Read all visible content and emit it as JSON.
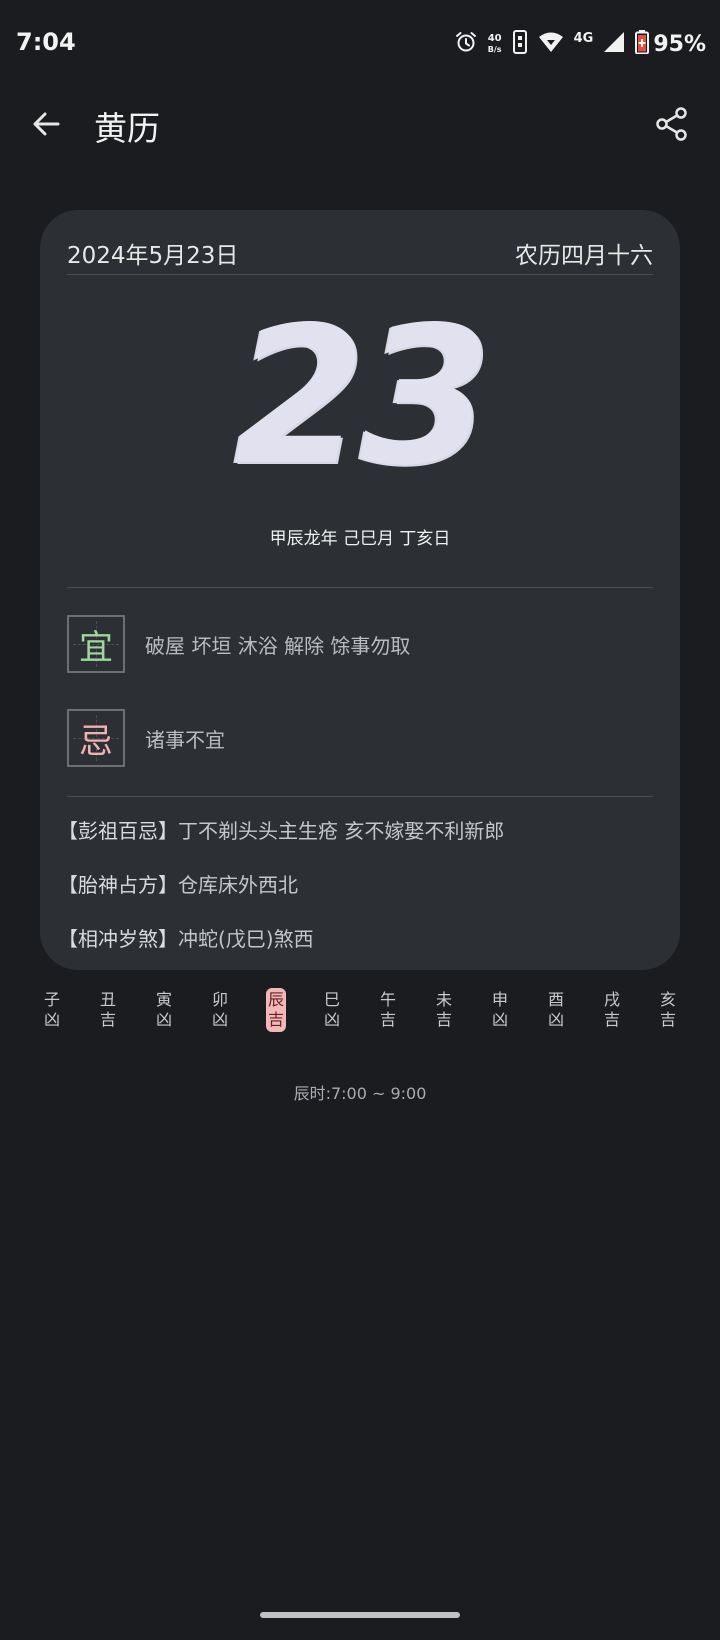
{
  "status_bar": {
    "time": "7:04",
    "net_speed_value": "40",
    "net_speed_unit": "B/s",
    "network_type": "4G",
    "battery_percent": "95%"
  },
  "app_bar": {
    "title": "黄历"
  },
  "card": {
    "solar_date": "2024年5月23日",
    "lunar_date": "农历四月十六",
    "day_number": "23",
    "ganzhi": "甲辰龙年 己巳月 丁亥日",
    "yi_char": "宜",
    "yi_text": "破屋 坏垣 沐浴 解除 馀事勿取",
    "ji_char": "忌",
    "ji_text": "诸事不宜",
    "pengzu_label": "【彭祖百忌】",
    "pengzu_text": "丁不剃头头主生疮 亥不嫁娶不利新郎",
    "taishen_label": "【胎神占方】",
    "taishen_text": "仓库床外西北",
    "chongsha_label": "【相冲岁煞】",
    "chongsha_text": "冲蛇(戊巳)煞西"
  },
  "hours": [
    {
      "branch": "子",
      "luck": "凶"
    },
    {
      "branch": "丑",
      "luck": "吉"
    },
    {
      "branch": "寅",
      "luck": "凶"
    },
    {
      "branch": "卯",
      "luck": "凶"
    },
    {
      "branch": "辰",
      "luck": "吉"
    },
    {
      "branch": "巳",
      "luck": "凶"
    },
    {
      "branch": "午",
      "luck": "吉"
    },
    {
      "branch": "未",
      "luck": "吉"
    },
    {
      "branch": "申",
      "luck": "凶"
    },
    {
      "branch": "酉",
      "luck": "凶"
    },
    {
      "branch": "戌",
      "luck": "吉"
    },
    {
      "branch": "亥",
      "luck": "吉"
    }
  ],
  "selected_hour_caption": "辰时:7:00 ~ 9:00",
  "icons": {
    "alarm": "alarm-icon",
    "vibrate": "vibrate-icon",
    "wifi": "wifi-icon",
    "signal": "signal-icon",
    "battery": "battery-saver-icon",
    "back": "arrow-left-icon",
    "share": "share-icon"
  },
  "colors": {
    "background": "#1a1c1f",
    "card": "#2c2f33",
    "yi": "#9fd79d",
    "ji": "#efb1b1",
    "selected_hour": "#f2b7b7"
  }
}
